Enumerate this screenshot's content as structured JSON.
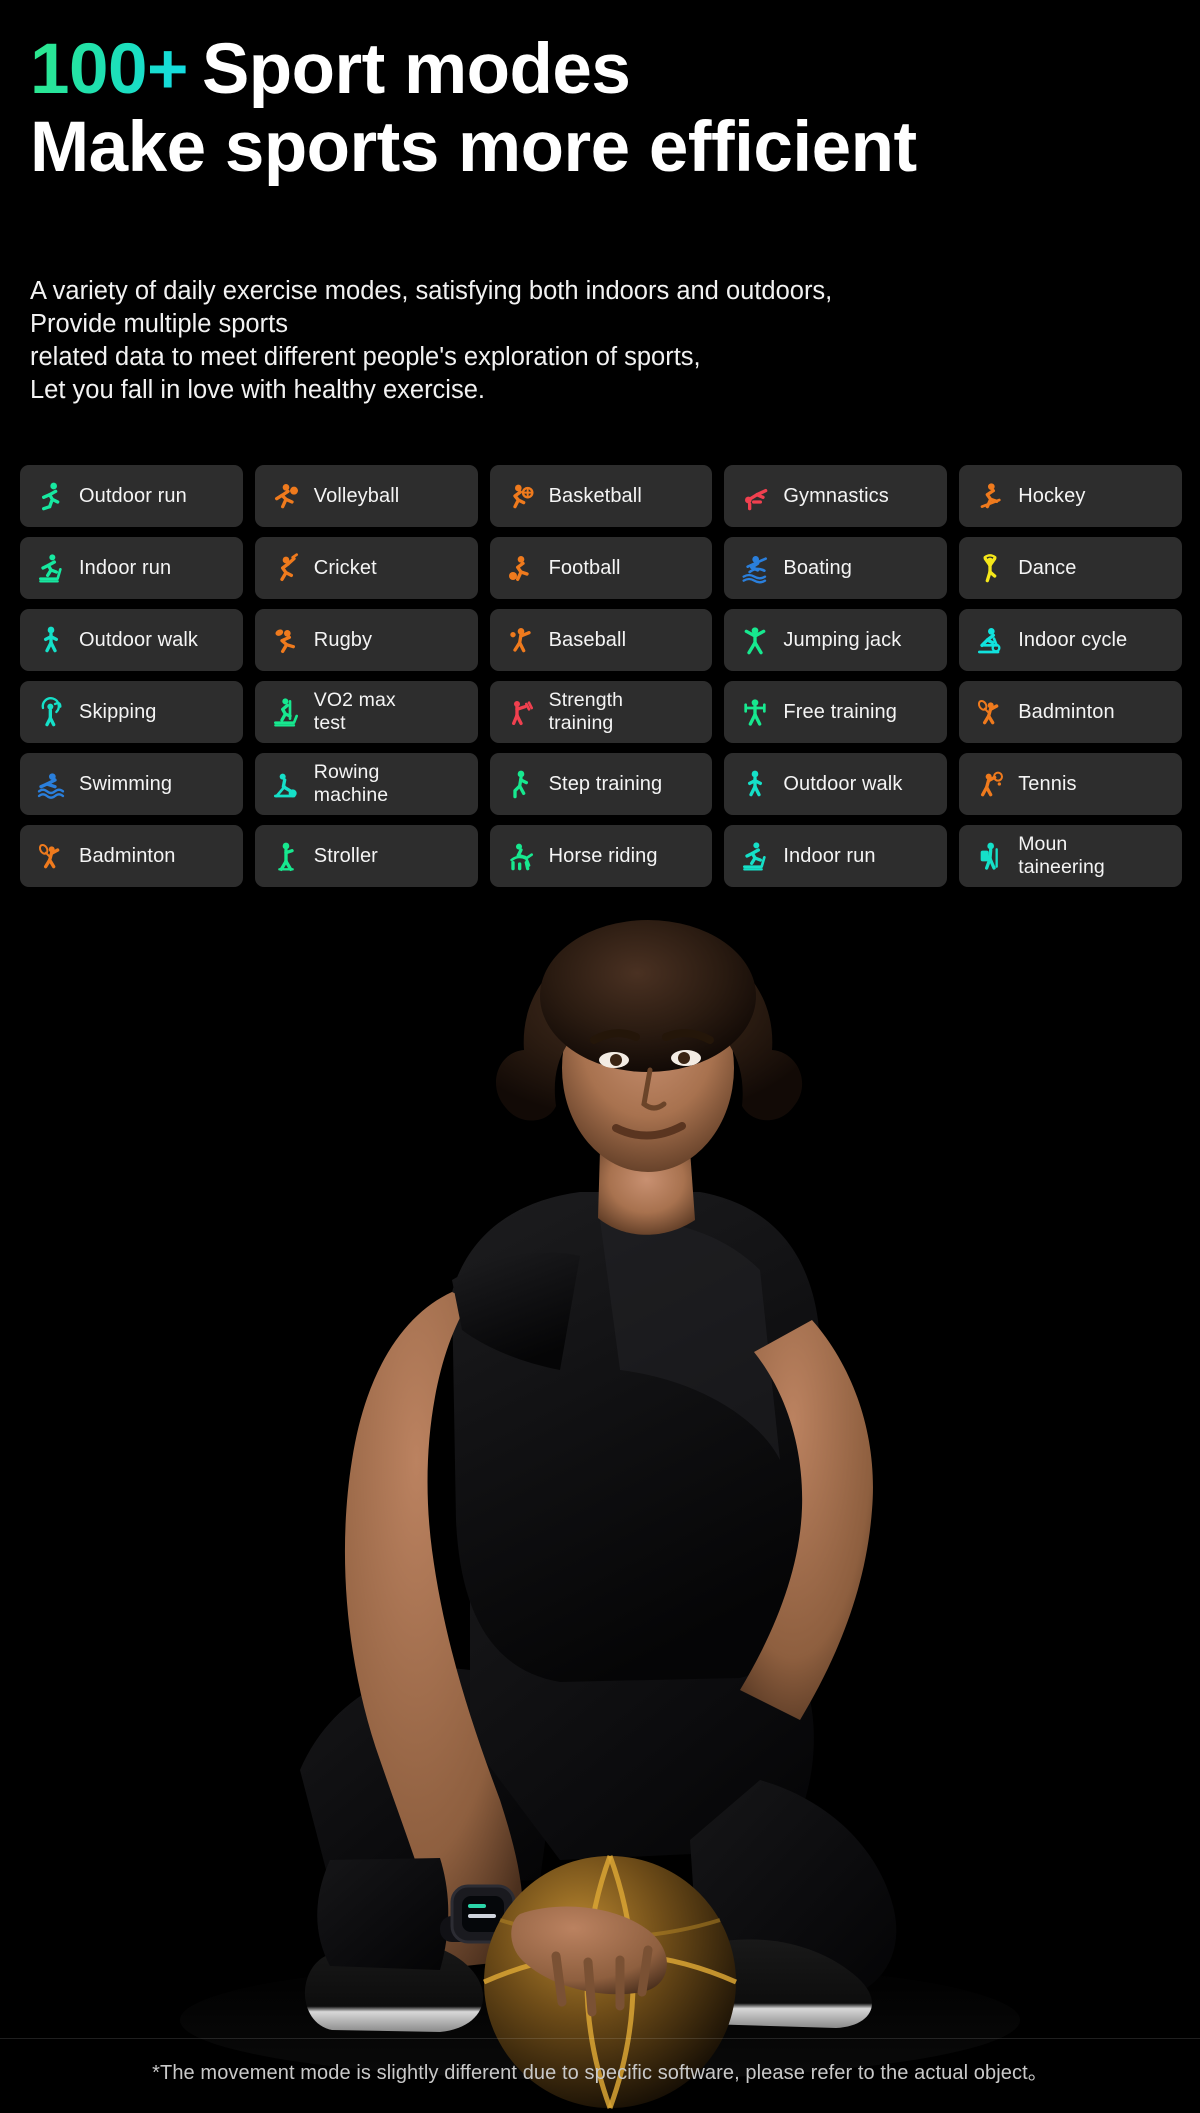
{
  "headline": {
    "count": "100+",
    "line1_rest": "Sport modes",
    "line2": "Make sports more efficient",
    "count_gradient_from": "#2ee88a",
    "count_gradient_to": "#12dbe6"
  },
  "intro": {
    "line1": "A variety of daily exercise modes, satisfying both indoors and outdoors,",
    "line2": "Provide multiple sports",
    "line3": "related data to meet different people's exploration of sports,",
    "line4": "Let you fall in love with healthy exercise."
  },
  "colors": {
    "chip_background": "#2d2d2d",
    "page_background": "#000000",
    "green": "#17e88f",
    "teal": "#15e0c8",
    "cyan": "#11e2dd",
    "orange": "#f07c1e",
    "red": "#f0404f",
    "blue": "#2a7fdc",
    "yellow": "#f5e71a",
    "text": "#f4f4f4"
  },
  "modes": [
    {
      "label": "Outdoor run",
      "icon": "outdoor-run-icon",
      "color": "#17e8a0"
    },
    {
      "label": "Volleyball",
      "icon": "volleyball-icon",
      "color": "#ef7a1d"
    },
    {
      "label": "Basketball",
      "icon": "basketball-icon",
      "color": "#ef7a1d"
    },
    {
      "label": "Gymnastics",
      "icon": "gymnastics-icon",
      "color": "#f0404f"
    },
    {
      "label": "Hockey",
      "icon": "hockey-icon",
      "color": "#ef7a1d"
    },
    {
      "label": "Indoor run",
      "icon": "indoor-run-icon",
      "color": "#17e8a0"
    },
    {
      "label": "Cricket",
      "icon": "cricket-icon",
      "color": "#ef7a1d"
    },
    {
      "label": "Football",
      "icon": "football-icon",
      "color": "#ef7a1d"
    },
    {
      "label": "Boating",
      "icon": "boating-icon",
      "color": "#2a7fdc"
    },
    {
      "label": "Dance",
      "icon": "dance-icon",
      "color": "#f5e71a"
    },
    {
      "label": "Outdoor walk",
      "icon": "outdoor-walk-icon",
      "color": "#15e0c8"
    },
    {
      "label": "Rugby",
      "icon": "rugby-icon",
      "color": "#ef7a1d"
    },
    {
      "label": "Baseball",
      "icon": "baseball-icon",
      "color": "#ef7a1d"
    },
    {
      "label": "Jumping jack",
      "icon": "jumping-jack-icon",
      "color": "#17e88f"
    },
    {
      "label": "Indoor cycle",
      "icon": "indoor-cycle-icon",
      "color": "#11e2dd"
    },
    {
      "label": "Skipping",
      "icon": "skipping-icon",
      "color": "#15e0c8"
    },
    {
      "label": "VO2 max\ntest",
      "icon": "vo2-max-test-icon",
      "color": "#17e88f",
      "two_line": true
    },
    {
      "label": "Strength\ntraining",
      "icon": "strength-training-icon",
      "color": "#f0404f",
      "two_line": true
    },
    {
      "label": "Free training",
      "icon": "free-training-icon",
      "color": "#17e88f"
    },
    {
      "label": "Badminton",
      "icon": "badminton-icon",
      "color": "#ef7a1d"
    },
    {
      "label": "Swimming",
      "icon": "swimming-icon",
      "color": "#2a7fdc"
    },
    {
      "label": "Rowing\nmachine",
      "icon": "rowing-machine-icon",
      "color": "#15e0c8",
      "two_line": true
    },
    {
      "label": "Step training",
      "icon": "step-training-icon",
      "color": "#17e88f"
    },
    {
      "label": "Outdoor walk",
      "icon": "outdoor-walk-icon",
      "color": "#15e0c8"
    },
    {
      "label": "Tennis",
      "icon": "tennis-icon",
      "color": "#ef7a1d"
    },
    {
      "label": "Badminton",
      "icon": "badminton-icon",
      "color": "#ef7a1d"
    },
    {
      "label": "Stroller",
      "icon": "stroller-icon",
      "color": "#17e88f"
    },
    {
      "label": "Horse riding",
      "icon": "horse-riding-icon",
      "color": "#17e88f"
    },
    {
      "label": "Indoor run",
      "icon": "indoor-run-icon",
      "color": "#15e0c8"
    },
    {
      "label": "Moun\ntaineering",
      "icon": "mountaineering-icon",
      "color": "#15e0c8",
      "two_line": true
    }
  ],
  "more_indicator": {
    "dot_count": 6
  },
  "footer": {
    "note": "*The movement mode is slightly different due to specific software, please refer to the actual object。"
  }
}
